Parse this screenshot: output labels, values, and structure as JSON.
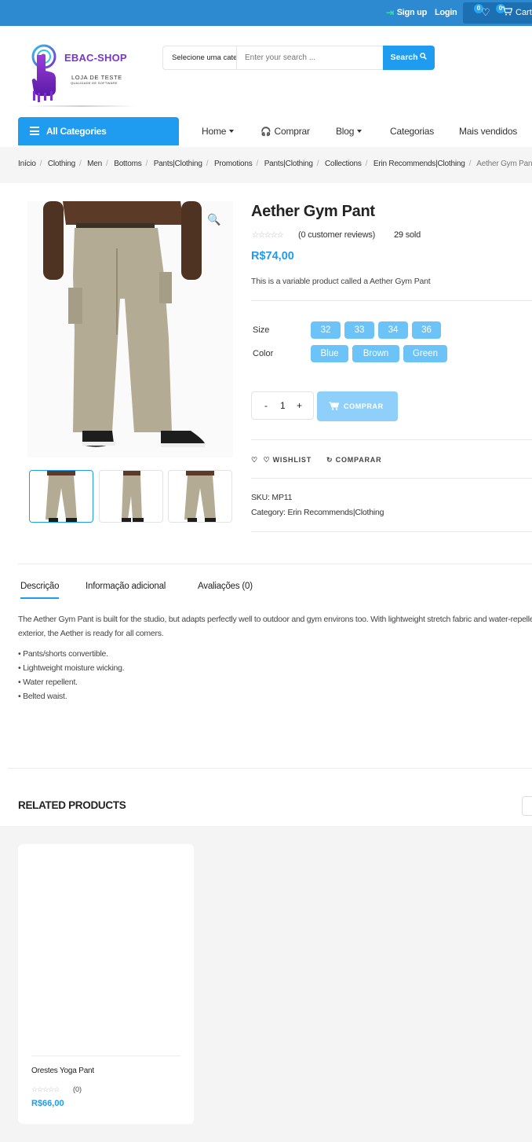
{
  "colors": {
    "topbar": "#2d8ad1",
    "accent": "#1f9bf0",
    "chip": "#6cc3f7",
    "brand": "#7a35c9"
  },
  "topbar": {
    "signup_label": "Sign up",
    "login_label": "Login",
    "wishlist_count": "0",
    "cart_count": "0",
    "cart_label": "Cart"
  },
  "logo": {
    "brand": "EBAC-SHOP",
    "tagline": "LOJA DE TESTE",
    "sub_tagline": "QUALIDADE DE SOFTWARE"
  },
  "search": {
    "category": "Selecione uma categoria",
    "placeholder": "Enter your search ...",
    "button": "Search"
  },
  "nav": {
    "all_categories": "All Categories",
    "items": [
      "Home",
      "Comprar",
      "Blog",
      "Categorias",
      "Mais vendidos"
    ]
  },
  "breadcrumb": [
    "Início",
    "Clothing",
    "Men",
    "Bottoms",
    "Pants|Clothing",
    "Promotions",
    "Pants|Clothing",
    "Collections",
    "Erin Recommends|Clothing",
    "Aether Gym Pant"
  ],
  "product": {
    "title": "Aether Gym Pant",
    "reviews": "(0 customer reviews)",
    "sold_count": "29",
    "sold_label": "sold",
    "price": "R$74,00",
    "short_description": "This is a variable product called a Aether Gym Pant",
    "size_label": "Size",
    "sizes": [
      "32",
      "33",
      "34",
      "36"
    ],
    "color_label": "Color",
    "colors": [
      "Blue",
      "Brown",
      "Green"
    ],
    "qty_minus": "-",
    "quantity": "1",
    "qty_plus": "+",
    "add_to_cart": "COMPRAR",
    "wishlist": "WISHLIST",
    "compare": "COMPARAR",
    "sku": "SKU: MP11",
    "category_label": "Category: ",
    "category": "Erin Recommends|Clothing"
  },
  "tabs": [
    "Descrição",
    "Informação adicional",
    "Avaliações (0)"
  ],
  "description": {
    "paragraph": "The Aether Gym Pant is built for the studio, but adapts perfectly well to outdoor and gym environs too. With lightweight stretch fabric and water-repellent exterior, the Aether is ready for all comers.",
    "bullets": [
      "• Pants/shorts convertible.",
      "• Lightweight moisture wicking.",
      "• Water repellent.",
      "• Belted waist."
    ]
  },
  "related": {
    "title": "RELATED PRODUCTS",
    "products": [
      {
        "name": "Orestes Yoga Pant",
        "reviews": "(0)",
        "price": "R$66,00"
      }
    ]
  }
}
